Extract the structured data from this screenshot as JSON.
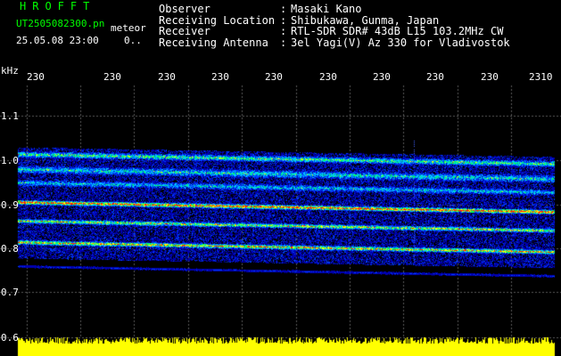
{
  "header": {
    "app_title": "HROFFT",
    "file_name": "UT2505082300.pn",
    "mode": "meteor",
    "datetime": "25.05.08 23:00",
    "count": "0.."
  },
  "station_info": [
    {
      "key": "Observer",
      "sep": ":",
      "value": "Masaki Kano"
    },
    {
      "key": "Receiving Location",
      "sep": ":",
      "value": "Shibukawa, Gunma, Japan"
    },
    {
      "key": "Receiver",
      "sep": ":",
      "value": "RTL-SDR SDR# 43dB L15 103.2MHz CW"
    },
    {
      "key": "Receiving Antenna",
      "sep": ":",
      "value": "3el Yagi(V) Az 330 for Vladivostok"
    }
  ],
  "axis": {
    "unit": "kHz",
    "time_ticks": [
      "230",
      "230",
      "230",
      "230",
      "230",
      "230",
      "230",
      "230",
      "230",
      "2310"
    ],
    "freq_ticks": [
      "1.1",
      "1.0",
      "0.9",
      "0.8",
      "0.7",
      "0.6"
    ]
  },
  "colors": {
    "background": "#000000",
    "title_green": "#00ff00",
    "text": "#ffffff",
    "noise_blue": "#0000c8",
    "signal_cyan": "#00e0ff",
    "signal_green": "#00ff60",
    "signal_yellow": "#ffff00",
    "signal_red": "#ff2000",
    "bar_yellow": "#ffff00"
  }
}
